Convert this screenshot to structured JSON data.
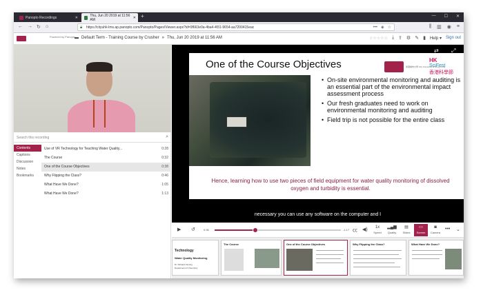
{
  "browser": {
    "tabs": [
      {
        "label": "Panopto Recordings",
        "active": false
      },
      {
        "label": "Thu, Jun 20 2019 at 11:56 AM",
        "active": true
      }
    ],
    "url": "https://cityuhk-lms.ap.panopto.com/Panopto/Pages/Viewer.aspx?id=9f663e0a-4ba4-4f31-9654-aa7200415eac"
  },
  "header": {
    "powered_by": "Powered by Panopto",
    "breadcrumb_folder": "Default Term - Training Course by Crusher",
    "breadcrumb_session": "Thu, Jun 20 2019 at 11:56 AM",
    "help_label": "Help",
    "signout_label": "Sign out"
  },
  "sidebar": {
    "search_placeholder": "Search this recording",
    "tabs": [
      "Contents",
      "Captions",
      "Discussion",
      "Notes",
      "Bookmarks"
    ],
    "active_tab": "Contents",
    "contents": [
      {
        "title": "Use of VR Technology for Teaching Water Quality...",
        "time": "0:28"
      },
      {
        "title": "The Course",
        "time": "0:32"
      },
      {
        "title": "One of the Course Objectives",
        "time": "0:38",
        "active": true
      },
      {
        "title": "Why Flipping the Class?",
        "time": "0:46"
      },
      {
        "title": "What Have We Done?",
        "time": "1:05"
      },
      {
        "title": "What Have We Done?",
        "time": "1:13"
      }
    ]
  },
  "slide": {
    "title": "One of the Course Objectives",
    "logo_cityu_text": "香港城市大學 City University of Hong Kong",
    "logo_scifest_line1": "HK",
    "logo_scifest_line2": "SciFest",
    "logo_scifest_cn": "香港科學節",
    "bullets": [
      "On-site environmental monitoring and auditing is an essential part of the environmental impact assessment process",
      "Our fresh graduates need to work on environmental monitoring and auditing",
      "Field trip is not possible for the entire class"
    ],
    "footer_text": "Hence, learning how to use two pieces of field equipment for water quality monitoring of dissolved oxygen and turbidity is essential."
  },
  "caption": "necessary you can use any software on the computer and I",
  "player": {
    "current_time": "0:36",
    "remaining_time": "-1:17",
    "progress": 0.32,
    "speed_value": "1x",
    "buttons": [
      {
        "label": "Speed",
        "icon": "speed-icon"
      },
      {
        "label": "Quality",
        "icon": "quality-icon"
      },
      {
        "label": "Slides",
        "icon": "slides-icon"
      },
      {
        "label": "Screen",
        "icon": "screen-icon",
        "active": true
      },
      {
        "label": "Camera",
        "icon": "camera-icon"
      }
    ]
  },
  "thumbnails": [
    {
      "title": "Technology"
    },
    {
      "title": "The Course"
    },
    {
      "title": "One of the Course Objectives"
    },
    {
      "title": "Why Flipping the Class?"
    },
    {
      "title": "What Have We Done?"
    }
  ],
  "thumb_extra": {
    "line1": "Water Quality Monitoring",
    "line2": "Dr. Richard Kinning",
    "line3": "Department of Chemistry"
  },
  "colors": {
    "brand": "#a3224b",
    "link": "#3b6ea5"
  }
}
